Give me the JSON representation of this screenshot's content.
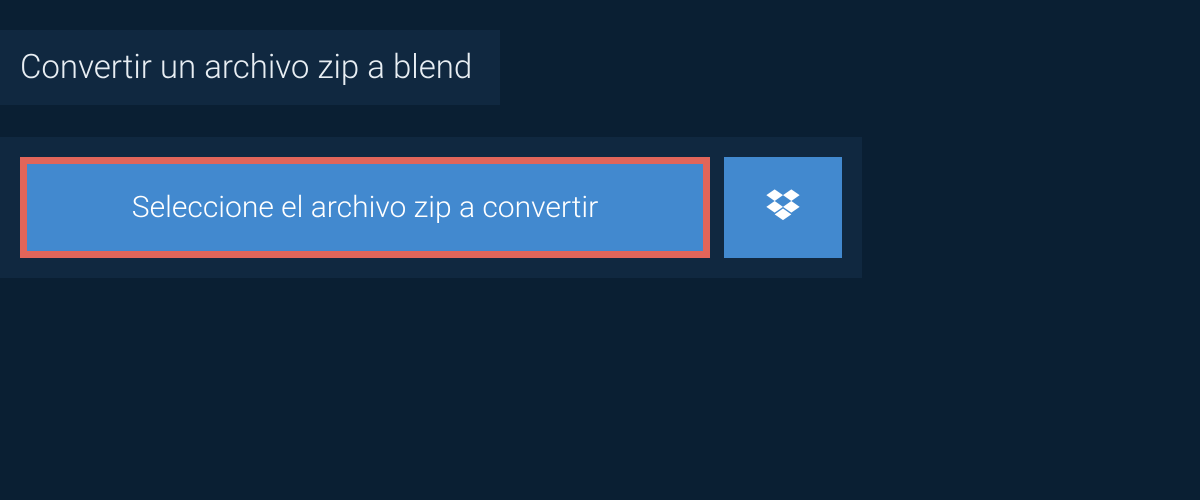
{
  "header": {
    "title": "Convertir un archivo zip a blend"
  },
  "upload": {
    "select_label": "Seleccione el archivo zip a convertir"
  },
  "colors": {
    "page_bg": "#0a1f33",
    "panel_bg": "#102840",
    "button_bg": "#4289cf",
    "highlight_border": "#e1655a",
    "text_light": "#e8eef3"
  }
}
